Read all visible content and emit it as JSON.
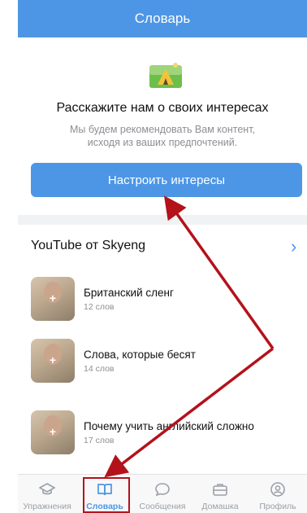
{
  "header": {
    "title": "Словарь"
  },
  "interests": {
    "title": "Расскажите нам о своих интересах",
    "subtitle": "Мы будем рекомендовать Вам контент, исходя из ваших предпочтений.",
    "button_label": "Настроить интересы",
    "illustration_icon": "tent-landscape-icon"
  },
  "section": {
    "title": "YouTube от Skyeng",
    "chevron": "›",
    "items": [
      {
        "name": "Британский сленг",
        "count": "12 слов"
      },
      {
        "name": "Слова, которые бесят",
        "count": "14 слов"
      },
      {
        "name": "Почему учить английский сложно",
        "count": "17 слов"
      }
    ]
  },
  "tabbar": {
    "tabs": [
      {
        "label": "Упражнения",
        "icon": "graduation-cap-icon"
      },
      {
        "label": "Словарь",
        "icon": "book-icon",
        "active": true
      },
      {
        "label": "Сообщения",
        "icon": "chat-bubble-icon"
      },
      {
        "label": "Домашка",
        "icon": "briefcase-icon"
      },
      {
        "label": "Профиль",
        "icon": "profile-icon"
      }
    ]
  },
  "colors": {
    "accent": "#4d96e6",
    "annotation": "#b3121b",
    "inactive": "#9aa0a6"
  }
}
